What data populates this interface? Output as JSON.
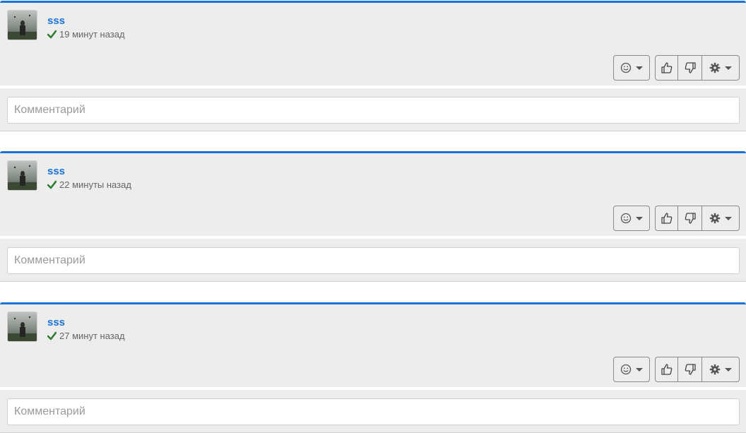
{
  "posts": [
    {
      "author": "sss",
      "time": "19 минут назад",
      "comment_placeholder": "Комментарий"
    },
    {
      "author": "sss",
      "time": "22 минуты назад",
      "comment_placeholder": "Комментарий"
    },
    {
      "author": "sss",
      "time": "27 минут назад",
      "comment_placeholder": "Комментарий"
    }
  ],
  "icons": {
    "verified": "check-icon",
    "emoji": "smiley-icon",
    "like": "thumbs-up-icon",
    "dislike": "thumbs-down-icon",
    "settings": "gear-icon",
    "dropdown": "caret-down-icon"
  },
  "colors": {
    "accent": "#1a73d6",
    "check": "#2e7d32",
    "panel_bg": "#ededed"
  }
}
